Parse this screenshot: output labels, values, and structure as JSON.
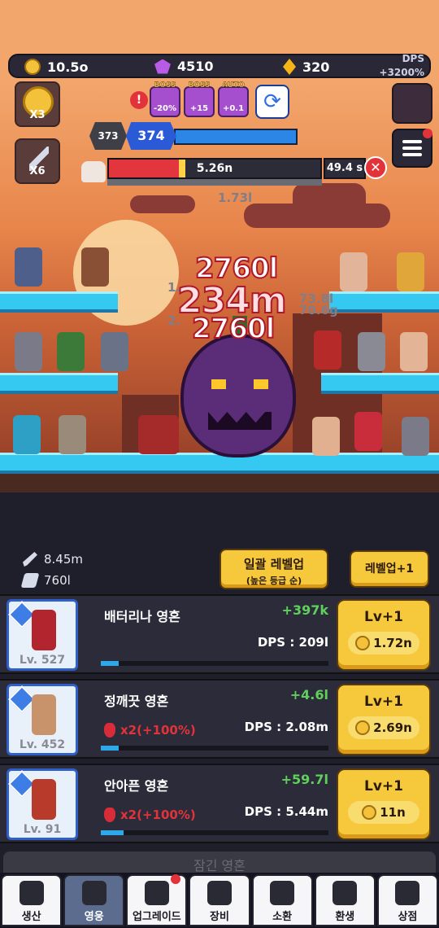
{
  "currency": {
    "gold": "10.5o",
    "gems": "4510",
    "amber": "320",
    "dps_label": "DPS",
    "dps_bonus": "+3200%"
  },
  "left_buttons": {
    "gold_multiplier": "X3",
    "attack_multiplier": "X6"
  },
  "boosts": [
    {
      "tag": "BOSS",
      "value": "-20%"
    },
    {
      "tag": "BOSS",
      "value": "+15"
    },
    {
      "tag": "AUTO",
      "value": "+0.1"
    }
  ],
  "alert_icon": "!",
  "stage": {
    "previous": "373",
    "current": "374"
  },
  "boss": {
    "hp": "5.26n",
    "hp_fraction": 0.33,
    "timer": "49.4 s"
  },
  "damage_numbers": {
    "big": "234m",
    "repeat": "2760l",
    "floating": [
      "1.73l",
      "1.",
      "2.",
      "73.8l",
      "70.6g"
    ]
  },
  "skills": [
    "fist-skill-icon",
    "dash-skill-icon",
    "meteor-skill-icon",
    "power-skill-icon",
    "spear-skill-icon",
    "burst-skill-icon",
    "shield-skill-icon"
  ],
  "stats": {
    "attack": "8.45m",
    "click": "760l"
  },
  "buttons": {
    "bulk_levelup": "일괄 레벨업",
    "bulk_levelup_sub": "(높은 등급 순)",
    "levelup_plus": "레벨업+1"
  },
  "heroes": [
    {
      "name": "배터리나 영혼",
      "level": "Lv. 527",
      "gain": "+397k",
      "dps": "DPS : 209l",
      "buff": "",
      "btn": "Lv+1",
      "cost": "1.72n",
      "progress": 0.08
    },
    {
      "name": "정깨끗 영혼",
      "level": "Lv. 452",
      "gain": "+4.6l",
      "dps": "DPS : 2.08m",
      "buff": "x2(+100%)",
      "btn": "Lv+1",
      "cost": "2.69n",
      "progress": 0.08
    },
    {
      "name": "안아픈 영혼",
      "level": "Lv. 91",
      "gain": "+59.7l",
      "dps": "DPS : 5.44m",
      "buff": "x2(+100%)",
      "btn": "Lv+1",
      "cost": "11n",
      "progress": 0.1
    }
  ],
  "locked_row": "잠긴 영혼",
  "nav": [
    "생산",
    "영웅",
    "업그레이드",
    "장비",
    "소환",
    "환생",
    "상점"
  ]
}
